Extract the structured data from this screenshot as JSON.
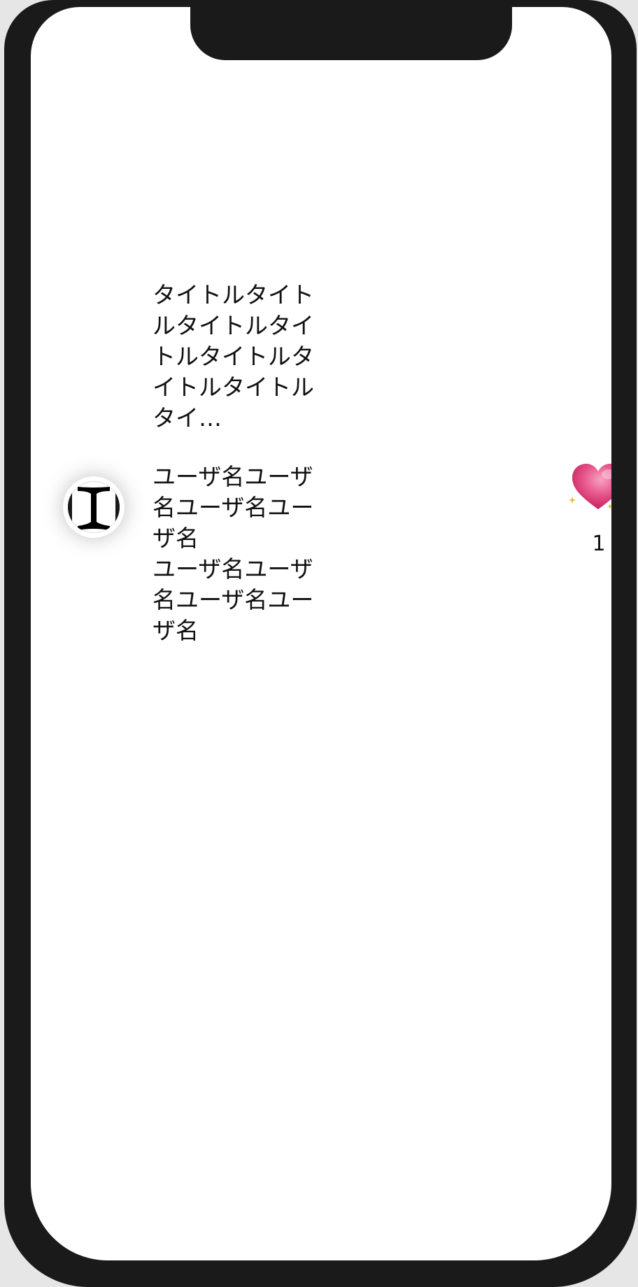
{
  "post": {
    "title": "タイトルタイトルタイトルタイトルタイトルタイトルタイトルタイ…",
    "username": "ユーザ名ユーザ名ユーザ名ユーザ名\nユーザ名ユーザ名ユーザ名ユーザ名",
    "like_count": "1"
  },
  "icons": {
    "avatar": "serif-i-cursor-icon",
    "like": "sparkling-heart-icon"
  },
  "colors": {
    "frame": "#1a1a1a",
    "heart": "#e0457b",
    "sparkle": "#f2b632"
  }
}
